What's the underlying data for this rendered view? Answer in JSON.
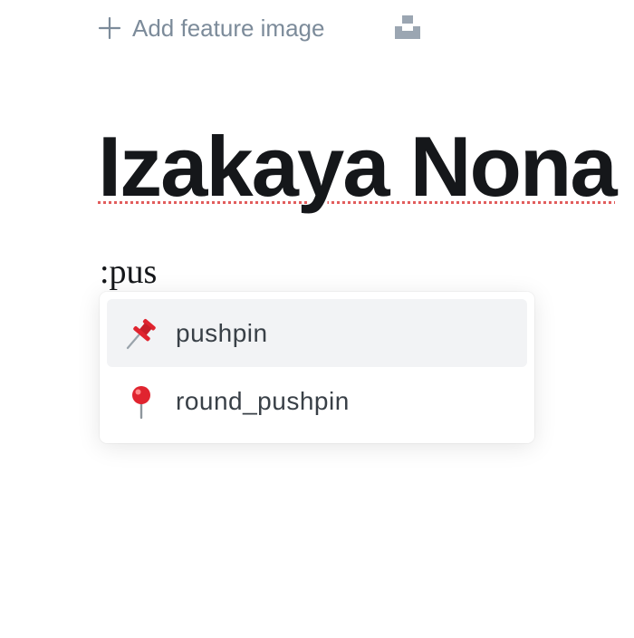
{
  "feature_image": {
    "label": "Add feature image",
    "icon": "plus-icon",
    "unsplash_icon": "unsplash-icon"
  },
  "post": {
    "title": "Izakaya Nona"
  },
  "editor": {
    "typed_text": ":pus"
  },
  "emoji_menu": {
    "items": [
      {
        "icon": "pushpin-icon",
        "label": "pushpin",
        "selected": true
      },
      {
        "icon": "round-pushpin-icon",
        "label": "round_pushpin",
        "selected": false
      }
    ]
  },
  "colors": {
    "text": "#15171a",
    "muted": "#7c8b9a",
    "spellcheck_underline": "#e25d5d",
    "selected_bg": "#f2f3f5"
  }
}
